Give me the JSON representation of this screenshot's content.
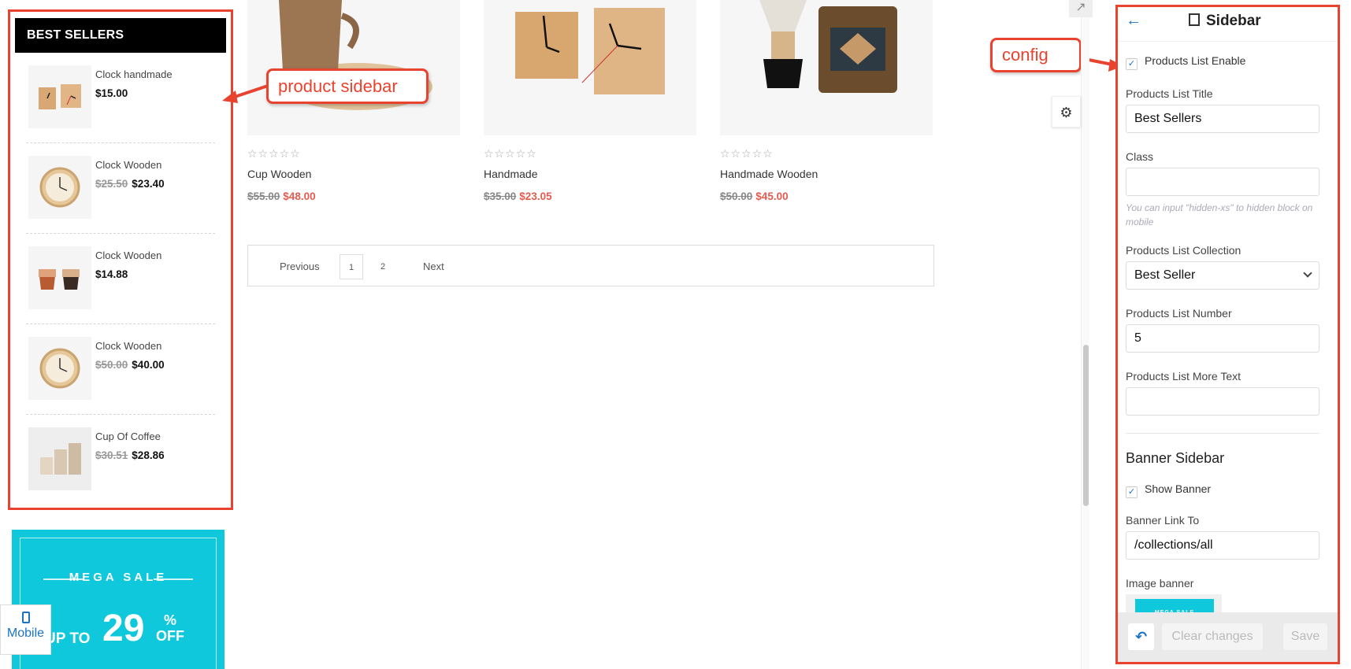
{
  "sidebar": {
    "title": "BEST SELLERS",
    "items": [
      {
        "name": "Clock handmade",
        "old_price": "",
        "price": "$15.00",
        "icon": "clock-blocks"
      },
      {
        "name": "Clock Wooden",
        "old_price": "$25.50",
        "price": "$23.40",
        "icon": "wall-clock"
      },
      {
        "name": "Clock Wooden",
        "old_price": "",
        "price": "$14.88",
        "icon": "cups"
      },
      {
        "name": "Clock Wooden",
        "old_price": "$50.00",
        "price": "$40.00",
        "icon": "wall-clock"
      },
      {
        "name": "Cup Of Coffee",
        "old_price": "$30.51",
        "price": "$28.86",
        "icon": "cups"
      }
    ]
  },
  "banner": {
    "title": "MEGA SALE",
    "upto": "UP TO",
    "number": "29",
    "pct_top": "%",
    "pct_bottom": "OFF",
    "color": "#10c8dc"
  },
  "mobile": {
    "label": "Mobile"
  },
  "products": [
    {
      "stars": "☆☆☆☆☆",
      "name": "Cup Wooden",
      "old_price": "$55.00",
      "price": "$48.00"
    },
    {
      "stars": "☆☆☆☆☆",
      "name": "Handmade",
      "old_price": "$35.00",
      "price": "$23.05"
    },
    {
      "stars": "☆☆☆☆☆",
      "name": "Handmade Wooden",
      "old_price": "$50.00",
      "price": "$45.00"
    }
  ],
  "pagination": {
    "previous": "Previous",
    "page1": "1",
    "page2": "2",
    "next": "Next"
  },
  "annotations": {
    "product_sidebar": "product sidebar",
    "config": "config"
  },
  "config": {
    "title": "Sidebar",
    "back_icon": "arrow-left-icon",
    "enable": {
      "label": "Products List Enable",
      "checked": true
    },
    "list_title": {
      "label": "Products List Title",
      "value": "Best Sellers"
    },
    "class": {
      "label": "Class",
      "value": "",
      "hint": "You can input \"hidden-xs\" to hidden block on mobile"
    },
    "collection": {
      "label": "Products List Collection",
      "value": "Best Seller"
    },
    "number": {
      "label": "Products List Number",
      "value": "5"
    },
    "more_text": {
      "label": "Products List More Text",
      "value": ""
    },
    "banner_section": "Banner Sidebar",
    "show_banner": {
      "label": "Show Banner",
      "checked": true
    },
    "link_to": {
      "label": "Banner Link To",
      "value": "/collections/all"
    },
    "image_banner": {
      "label": "Image banner",
      "thumb_text": "MEGA SALE"
    },
    "footer": {
      "clear": "Clear changes",
      "save": "Save"
    }
  },
  "colors": {
    "accent": "#1a73c8",
    "annotation": "#e8432f",
    "sale": "#e55b4f"
  }
}
